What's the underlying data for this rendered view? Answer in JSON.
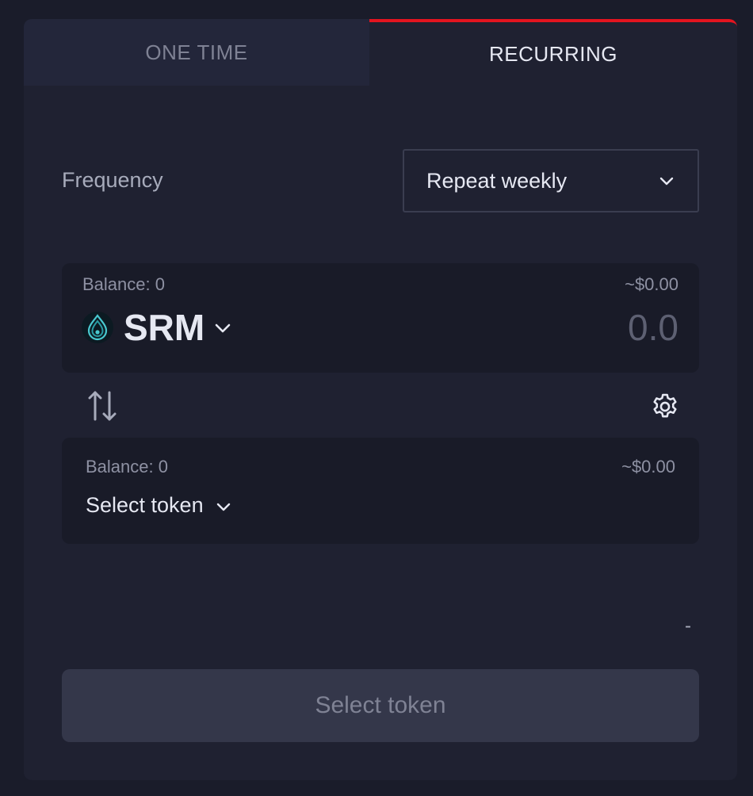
{
  "tabs": {
    "one_time": "ONE TIME",
    "recurring": "RECURRING",
    "active": "recurring"
  },
  "frequency": {
    "label": "Frequency",
    "selected": "Repeat weekly"
  },
  "from": {
    "balance": "Balance: 0",
    "usd": "~$0.00",
    "token": "SRM",
    "amount": "0.0"
  },
  "to": {
    "balance": "Balance: 0",
    "usd": "~$0.00",
    "token_placeholder": "Select token"
  },
  "rate": "-",
  "submit_label": "Select token",
  "colors": {
    "accent": "#e3141f",
    "background": "#1f2131",
    "panel": "#191b28",
    "button": "#34374a"
  },
  "icons": {
    "swap": "swap-arrows-icon",
    "settings": "gear-icon",
    "dropdown": "chevron-down-icon",
    "token": "srm-logo-icon"
  }
}
